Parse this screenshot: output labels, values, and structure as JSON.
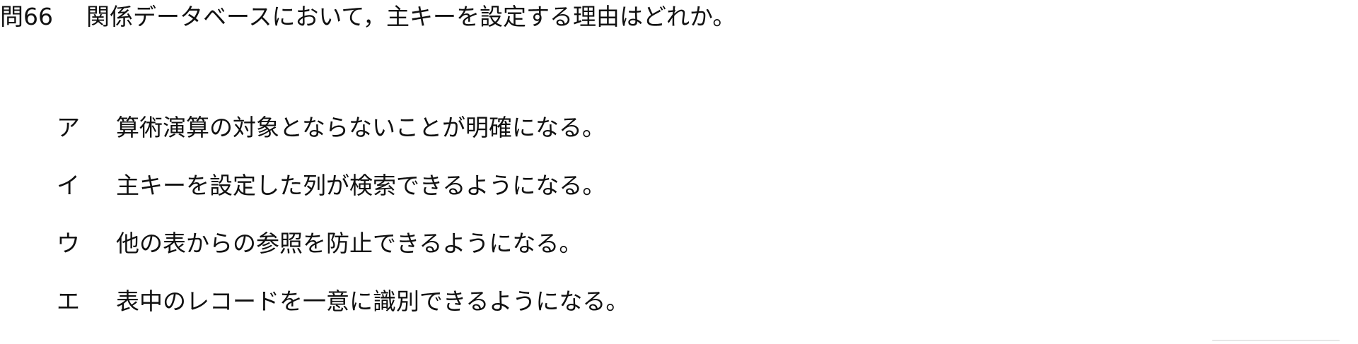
{
  "question": {
    "number": "問66",
    "text": "関係データベースにおいて，主キーを設定する理由はどれか。"
  },
  "choices": [
    {
      "letter": "ア",
      "text": "算術演算の対象とならないことが明確になる。"
    },
    {
      "letter": "イ",
      "text": "主キーを設定した列が検索できるようになる。"
    },
    {
      "letter": "ウ",
      "text": "他の表からの参照を防止できるようになる。"
    },
    {
      "letter": "エ",
      "text": "表中のレコードを一意に識別できるようになる。"
    }
  ]
}
